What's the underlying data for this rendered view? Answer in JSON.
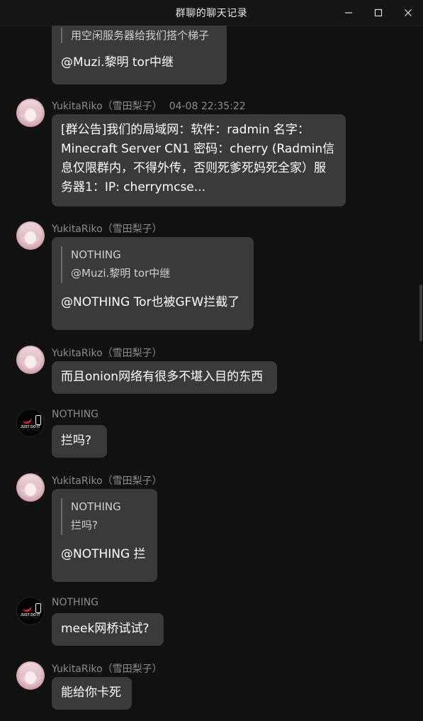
{
  "window": {
    "title": "群聊的聊天记录",
    "controls": {
      "minimize": "minimize-icon",
      "maximize": "maximize-icon",
      "close": "close-icon"
    }
  },
  "messages": [
    {
      "quote_text": "用空闲服务器给我们搭个梯子",
      "text": "@Muzi.黎明   tor中继"
    },
    {
      "sender": "YukitaRiko（雪田梨子）",
      "time": "04-08 22:35:22",
      "lines": [
        "[群公告]我们的局域网：软件：radmin 名字：",
        "Minecraft Server CN1 密码：cherry (Radmin信",
        "息仅限群内，不得外传，否则死爹死妈死全家）服",
        "务器1：IP: cherrymcse..."
      ]
    },
    {
      "sender": "YukitaRiko（雪田梨子）",
      "quote_name": "NOTHING",
      "quote_text": "@Muzi.黎明 tor中继",
      "text": "@NOTHING Tor也被GFW拦截了"
    },
    {
      "sender": "YukitaRiko（雪田梨子）",
      "text": "而且onion网络有很多不堪入目的东西"
    },
    {
      "sender": "NOTHING",
      "text": "拦吗?"
    },
    {
      "sender": "YukitaRiko（雪田梨子）",
      "quote_name": "NOTHING",
      "quote_text": "拦吗?",
      "text": "@NOTHING 拦"
    },
    {
      "sender": "NOTHING",
      "text": "meek网桥试试?"
    },
    {
      "sender": "YukitaRiko（雪田梨子）",
      "text": "能给你卡死"
    }
  ],
  "avatar_text": "JUST DO IT",
  "colors": {
    "background": "#111111",
    "bubble": "#3a3a3a",
    "name": "#8c8c8c"
  }
}
